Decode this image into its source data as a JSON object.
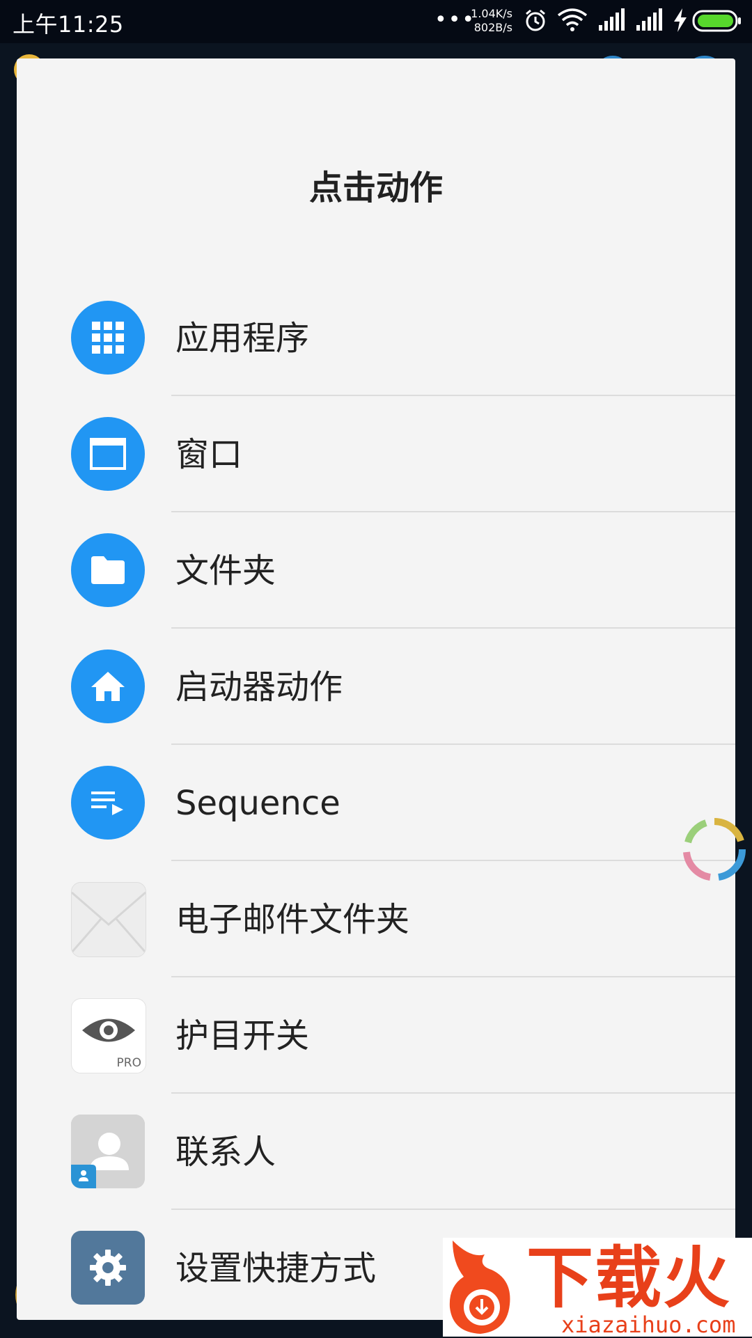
{
  "status_bar": {
    "time": "上午11:25",
    "more_dots": "•••",
    "speed_up": "1.04K/s",
    "speed_down": "802B/s",
    "icons": [
      "alarm-icon",
      "wifi-icon",
      "signal-icon",
      "signal-icon",
      "charging-icon",
      "battery-icon"
    ]
  },
  "dialog": {
    "title": "点击动作",
    "items": [
      {
        "label": "应用程序",
        "icon": "apps-grid-icon"
      },
      {
        "label": "窗口",
        "icon": "window-icon"
      },
      {
        "label": "文件夹",
        "icon": "folder-icon"
      },
      {
        "label": "启动器动作",
        "icon": "home-icon"
      },
      {
        "label": "Sequence",
        "icon": "playlist-icon"
      },
      {
        "label": "电子邮件文件夹",
        "icon": "email-envelope-icon"
      },
      {
        "label": "护目开关",
        "icon": "eye-pro-icon",
        "badge": "PRO"
      },
      {
        "label": "联系人",
        "icon": "contact-icon"
      },
      {
        "label": "设置快捷方式",
        "icon": "settings-gear-icon"
      }
    ]
  },
  "watermark": {
    "brand": "下载火",
    "url": "xiazaihuo.com"
  },
  "colors": {
    "accent_blue": "#2196f3",
    "dialog_bg": "#f4f4f4",
    "settings_icon_bg": "#52789b",
    "watermark_red": "#e8401a"
  }
}
